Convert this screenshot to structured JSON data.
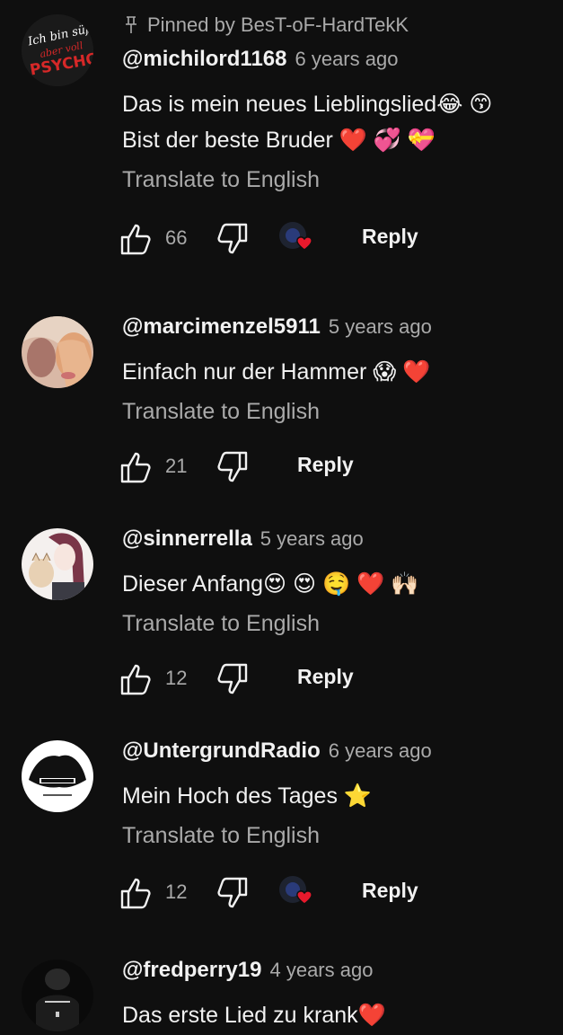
{
  "translate_label": "Translate to English",
  "reply_label": "Reply",
  "comments": [
    {
      "pinned_text": "Pinned by BesT-oF-HardTekK",
      "author": "@michilord1168",
      "time": "6 years ago",
      "lines": [
        "Das is mein neues Lieblingslied😂 😙",
        "Bist der beste Bruder ❤️ 💞 💝"
      ],
      "likes": "66",
      "creator_heart": true,
      "avatar_text": [
        "Ich bin süß",
        "aber voll",
        "PSYCHO!"
      ]
    },
    {
      "author": "@marcimenzel5911",
      "time": "5 years ago",
      "lines": [
        "Einfach nur der Hammer 😱 ❤️"
      ],
      "likes": "21",
      "creator_heart": false
    },
    {
      "author": "@sinnerrella",
      "time": "5 years ago",
      "lines": [
        "Dieser Anfang😍 😍 🤤 ❤️ 🙌🏻"
      ],
      "likes": "12",
      "creator_heart": false
    },
    {
      "author": "@UntergrundRadio",
      "time": "6 years ago",
      "lines": [
        "Mein Hoch des Tages ⭐"
      ],
      "likes": "12",
      "creator_heart": true
    },
    {
      "author": "@fredperry19",
      "time": "4 years ago",
      "lines": [
        "Das erste Lied zu krank❤️"
      ],
      "likes": "",
      "creator_heart": false
    }
  ]
}
